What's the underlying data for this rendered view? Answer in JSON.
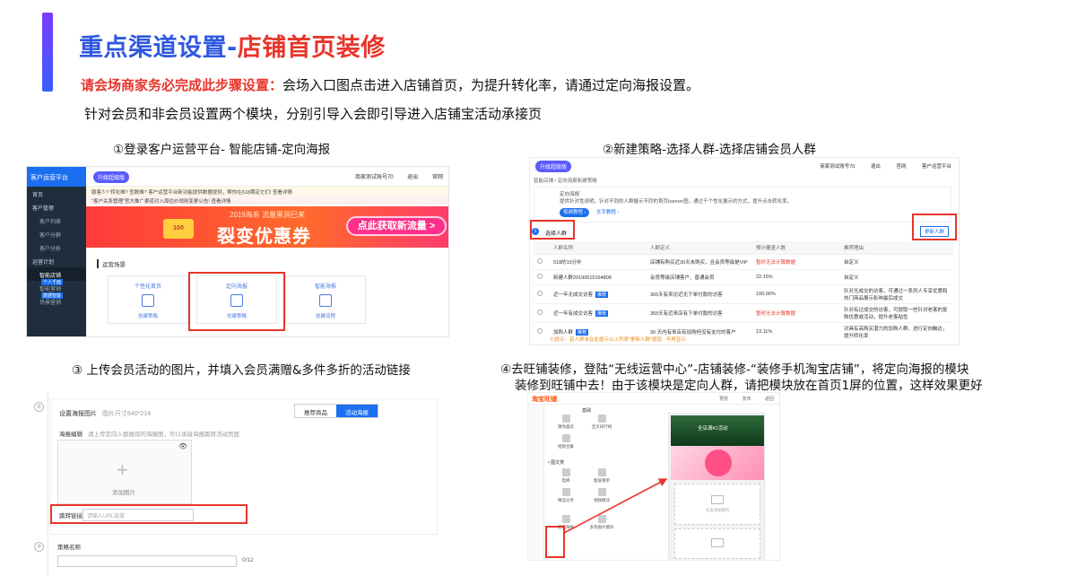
{
  "header": {
    "title_part1": "重点渠道设置-",
    "title_part2": "店铺首页装修",
    "line1_emphasis": "请会场商家务必完成此步骤设置：",
    "line1_rest": "会场入口图点击进入店铺首页，为提升转化率，请通过定向海报设置。",
    "line2": "针对会员和非会员设置两个模块，分别引导入会即引导进入店铺宝活动承接页"
  },
  "steps": {
    "s1": "①登录客户运营平台- 智能店铺-定向海报",
    "s2": "②新建策略-选择人群-选择店铺会员人群",
    "s3": "③ 上传会员活动的图片，并填入会员满赠&多件多折的活动链接",
    "s4_line1": "④去旺铺装修，登陆“无线运营中心”-店铺装修-“装修手机淘宝店铺”，将定向海报的模块",
    "s4_line2": "装修到旺铺中去！由于该模块是定向人群，请把模块放在首页1屏的位置，这样效果更好"
  },
  "panel1": {
    "brand": "客户运营平台",
    "upgrade": "升级超级版",
    "topbar_items": [
      "商家测试账号70",
      "退出",
      "官网"
    ],
    "notice1": "服客少? 转化难? 查数难? 客户运营平台新功能提供数据提供，帮你在618期定它们! 查看详情",
    "notice2": "\"客户关系管理\"官方推广渠道对入周估价规则变更公告! 查看详情",
    "menu": [
      {
        "label": "首页",
        "cls": ""
      },
      {
        "label": "客户管理",
        "cls": ""
      },
      {
        "label": "客户列表",
        "cls": "sub"
      },
      {
        "label": "客户分群",
        "cls": "sub"
      },
      {
        "label": "客户分析",
        "cls": "sub"
      },
      {
        "label": "运营计划",
        "cls": ""
      },
      {
        "label": "智能店铺",
        "cls": "sub sel",
        "tag": "个人千面"
      },
      {
        "label": "智能营销",
        "cls": "sub",
        "tag": "数据智能"
      },
      {
        "label": "场景营销",
        "cls": "sub"
      }
    ],
    "banner_small": "2019淘系 流量黑洞已来",
    "banner_big": "裂变优惠券",
    "banner_cta": "点此获取新流量 >",
    "coin_text": "100",
    "section_title": "运营场景",
    "cards": [
      {
        "title": "个性化首页",
        "btn": "创建策略"
      },
      {
        "title": "定向海报",
        "btn": "创建策略"
      },
      {
        "title": "智能海报",
        "btn": "创建流程"
      }
    ]
  },
  "panel2": {
    "upgrade": "升级超级版",
    "topbar_items": [
      "商家测试账号70",
      "退出",
      "官网",
      "客户运营平台"
    ],
    "crumb": "智能店铺 / 定向海报新建策略",
    "desc_title": "定向海报",
    "desc_text": "提供针对性说明，针对不同的人群展示不同的首页banner图，通过千个性化展示的方式，提升点击转化率。",
    "desc_btn": "视频教程 ›",
    "desc_link": "文字教程 ›",
    "select_label": "选择人群",
    "update_btn": "更新人群",
    "columns": [
      "人群名称",
      "人群定义",
      "预计覆盖人数",
      "推荐理由"
    ],
    "rows": [
      {
        "name": "518的15分补",
        "badge": "",
        "def": "店铺有购买近30天未购买，且会员等级是VIP",
        "count": "暂时无法计算数据",
        "warn": true,
        "reason": "自定义"
      },
      {
        "name": "新建人群20190515164808",
        "badge": "",
        "def": "会员等级店铺客户、普通会员",
        "count": "22.15%",
        "warn": false,
        "reason": "自定义"
      },
      {
        "name": "近一年无成交访客",
        "badge": "推荐",
        "def": "365天有来访近无下单付款的访客",
        "count": "100.00%",
        "warn": false,
        "reason": "针对无成交的访客，可通过一系列人专享优惠和热门商品展示影响最后成交"
      },
      {
        "name": "近一年有成交访客",
        "badge": "推荐",
        "def": "365天有近来店有下单付款的访客",
        "count": "暂时无法计算数据",
        "warn": true,
        "reason": "针对有过成交的访客，可提取一些针对老客的复购优惠或活动，提升老客粘性"
      },
      {
        "name": "加购人群",
        "badge": "推荐",
        "def": "30 天内有来店有加购但没有支付的客户",
        "count": "13.11%",
        "warn": false,
        "reason": "对具有高购买潜力的加购人群，进行定向触达，提升转化率"
      }
    ],
    "foot": "小提示：若人群未在此提示以上列表\"更新人群\"按钮 · 不再显示"
  },
  "panel3": {
    "header": "设置海报图片",
    "header_hint": "图片尺寸640*214",
    "tabs": [
      "推荐商品",
      "活动海报"
    ],
    "edit_label": "海报编辑",
    "edit_hint": "请上传定向人群展现的海报图，可以承接海报跳转活动页面",
    "upload_label": "添加图片",
    "eye": "👁",
    "link_label": "跳转链接:",
    "link_placeholder": "请输入URL链接",
    "name_label": "策略名称",
    "counter": "0/12",
    "num2": "②",
    "num3": "③",
    "plus": "+"
  },
  "panel4": {
    "logo": "淘宝旺铺",
    "topbar_items": [
      "预览",
      "发布",
      "返回"
    ],
    "group1": "基础",
    "group2": "• 图文类",
    "modules": [
      "猜你喜欢",
      "宝贝排行榜",
      "视频合集",
      "电梯",
      "超值猜单",
      "精品分享",
      "视频模块",
      "定向海报",
      "多热图片模块"
    ],
    "phone_slot_text": "点击添加模块",
    "phone_banner_text": "全店满¥1活动"
  }
}
